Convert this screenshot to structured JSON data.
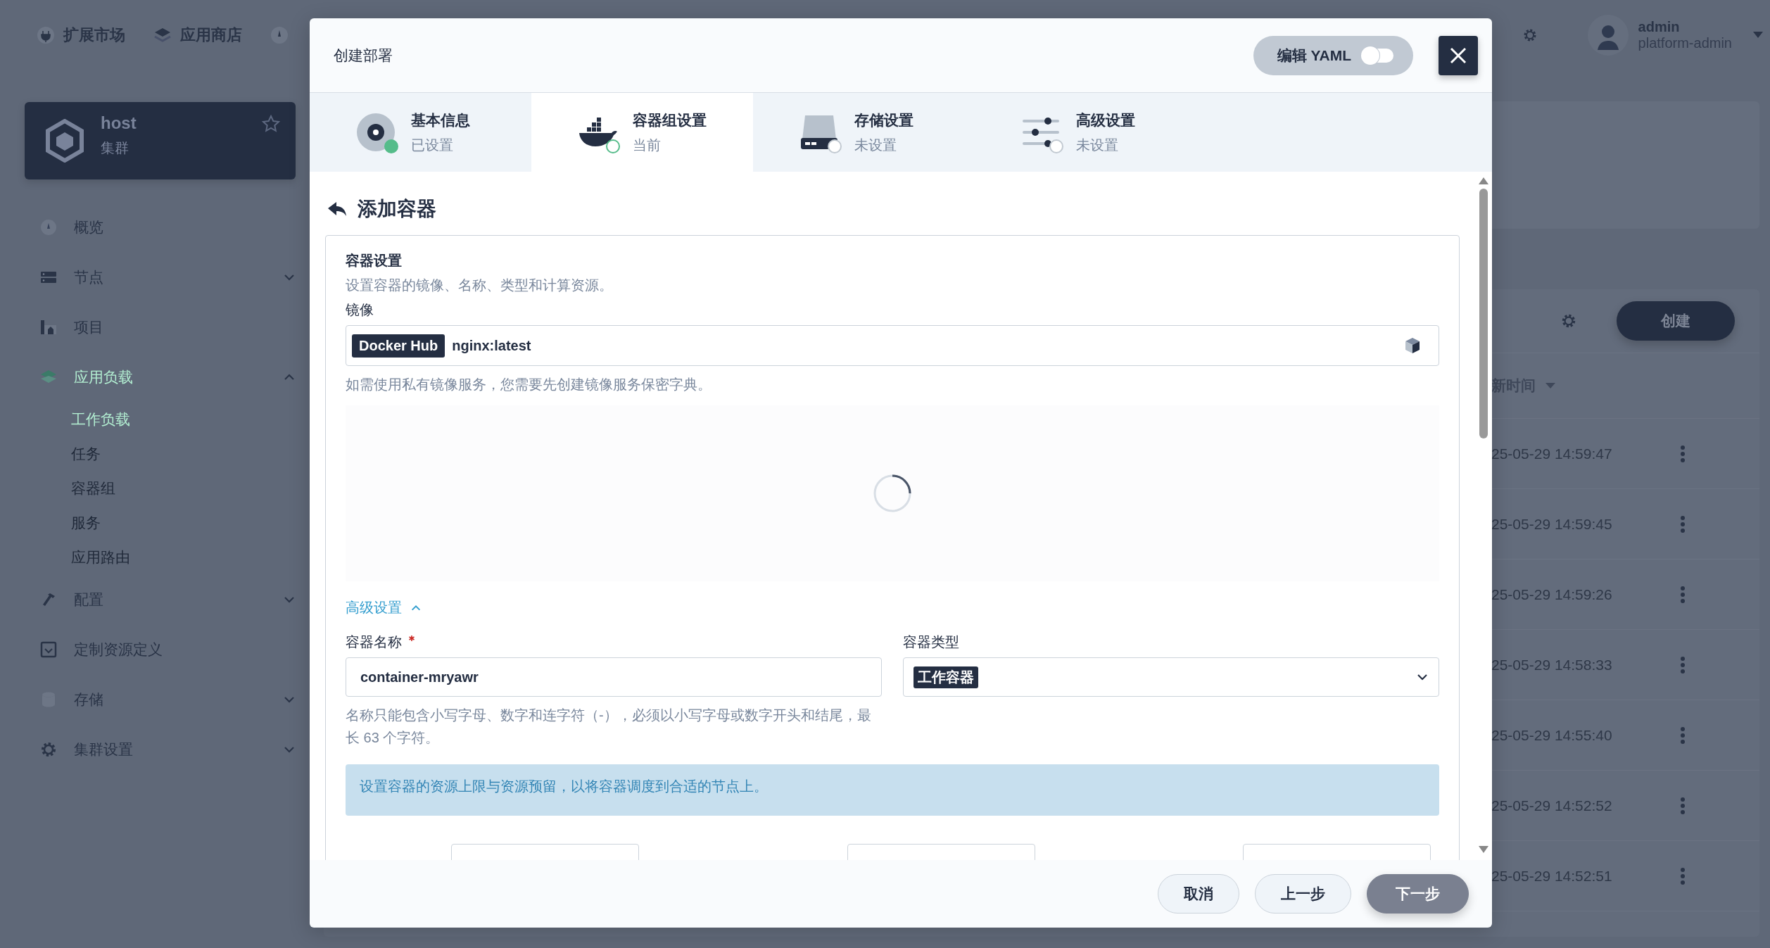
{
  "top_nav": [
    {
      "label": "扩展市场"
    },
    {
      "label": "应用商店"
    }
  ],
  "user": {
    "name": "admin",
    "role": "platform-admin"
  },
  "cluster": {
    "name": "host",
    "type": "集群"
  },
  "sidebar": {
    "items": [
      {
        "kind": "link",
        "label": "概览",
        "selected": false
      },
      {
        "kind": "group",
        "label": "节点",
        "selected": false,
        "expanded": false
      },
      {
        "kind": "link",
        "label": "项目",
        "selected": false
      },
      {
        "kind": "group",
        "label": "应用负载",
        "selected": true,
        "expanded": true,
        "children": [
          {
            "label": "工作负载",
            "selected": true
          },
          {
            "label": "任务",
            "selected": false
          },
          {
            "label": "容器组",
            "selected": false
          },
          {
            "label": "服务",
            "selected": false
          },
          {
            "label": "应用路由",
            "selected": false
          }
        ]
      },
      {
        "kind": "group",
        "label": "配置",
        "selected": false,
        "expanded": false
      },
      {
        "kind": "link",
        "label": "定制资源定义",
        "selected": false
      },
      {
        "kind": "group",
        "label": "存储",
        "selected": false,
        "expanded": false
      },
      {
        "kind": "group",
        "label": "集群设置",
        "selected": false,
        "expanded": false
      }
    ]
  },
  "workloads": {
    "create_button": "创建",
    "sort_column": "新时间",
    "rows": [
      {
        "time": "25-05-29 14:59:47"
      },
      {
        "time": "25-05-29 14:59:45"
      },
      {
        "time": "25-05-29 14:59:26"
      },
      {
        "time": "25-05-29 14:58:33"
      },
      {
        "time": "25-05-29 14:55:40"
      },
      {
        "time": "25-05-29 14:52:52"
      },
      {
        "time": "25-05-29 14:52:51"
      }
    ]
  },
  "modal": {
    "title": "创建部署",
    "yaml_toggle": {
      "label": "编辑 YAML",
      "on": false
    },
    "steps": [
      {
        "title": "基本信息",
        "status_text": "已设置",
        "kind": "done",
        "selected": false
      },
      {
        "title": "容器组设置",
        "status_text": "当前",
        "kind": "current",
        "selected": true
      },
      {
        "title": "存储设置",
        "status_text": "未设置",
        "kind": "pending",
        "selected": false
      },
      {
        "title": "高级设置",
        "status_text": "未设置",
        "kind": "pending",
        "selected": false
      }
    ],
    "section_title": "添加容器",
    "card": {
      "title": "容器设置",
      "description": "设置容器的镜像、名称、类型和计算资源。",
      "image": {
        "label": "镜像",
        "registry": "Docker Hub",
        "value": "nginx:latest",
        "hint": "如需使用私有镜像服务，您需要先创建镜像服务保密字典。"
      },
      "loading": true,
      "advanced": {
        "label": "高级设置",
        "expanded": true
      },
      "name_field": {
        "label": "容器名称",
        "required": true,
        "value": "container-mryawr",
        "hint": "名称只能包含小写字母、数字和连字符（-），必须以小写字母或数字开头和结尾，最长 63 个字符。"
      },
      "type_field": {
        "label": "容器类型",
        "value": "工作容器"
      },
      "info": "设置容器的资源上限与资源预留，以将容器调度到合适的节点上。"
    },
    "footer": [
      {
        "label": "取消",
        "kind": "default"
      },
      {
        "label": "上一步",
        "kind": "default"
      },
      {
        "label": "下一步",
        "kind": "primary"
      }
    ]
  }
}
